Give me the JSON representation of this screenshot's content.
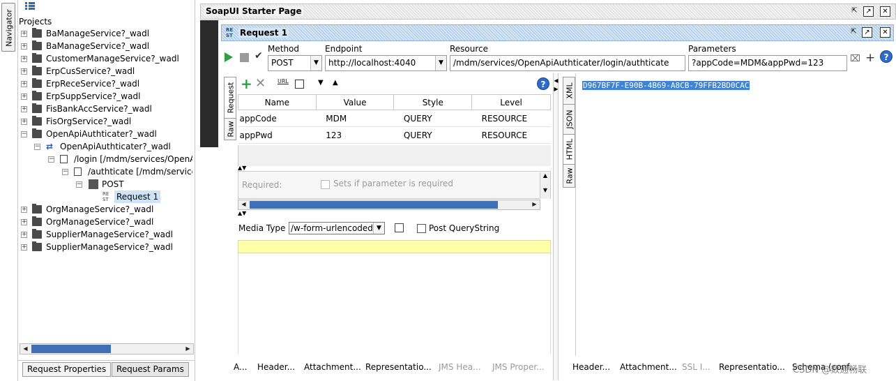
{
  "navigator": {
    "tab_label": "Navigator",
    "root_label": "Projects",
    "items": [
      {
        "label": "BaManageService?_wadl"
      },
      {
        "label": "BaManageService?_wadl"
      },
      {
        "label": "CustomerManageService?_wadl"
      },
      {
        "label": "ErpCusService?_wadl"
      },
      {
        "label": "ErpReceService?_wadl"
      },
      {
        "label": "ErpSuppService?_wadl"
      },
      {
        "label": "FisBankAccService?_wadl"
      },
      {
        "label": "FisOrgService?_wadl"
      },
      {
        "label": "OpenApiAuthticater?_wadl"
      },
      {
        "label": "OpenApiAuthticater?_wadl"
      },
      {
        "label": "/login [/mdm/services/OpenA"
      },
      {
        "label": "/authticate [/mdm/service"
      },
      {
        "label": "POST"
      },
      {
        "label": "Request 1"
      },
      {
        "label": "OrgManageService?_wadl"
      },
      {
        "label": "OrgManageService?_wadl"
      },
      {
        "label": "SupplierManageService?_wadl"
      },
      {
        "label": "SupplierManageService?_wadl"
      }
    ],
    "bottom_tabs": [
      "Request Properties",
      "Request Params"
    ]
  },
  "starter": {
    "title": "SoapUI Starter Page"
  },
  "request": {
    "title": "Request 1",
    "icon_text": "RE ST",
    "method": {
      "label": "Method",
      "value": "POST"
    },
    "endpoint": {
      "label": "Endpoint",
      "value": "http://localhost:4040"
    },
    "resource": {
      "label": "Resource",
      "value": "/mdm/services/OpenApiAuthticater/login/authticate"
    },
    "parameters": {
      "label": "Parameters",
      "value": "?appCode=MDM&appPwd=123"
    },
    "side_tabs": [
      "Request",
      "Raw"
    ],
    "table": {
      "headers": [
        "Name",
        "Value",
        "Style",
        "Level"
      ],
      "rows": [
        [
          "appCode",
          "MDM",
          "QUERY",
          "RESOURCE"
        ],
        [
          "appPwd",
          "123",
          "QUERY",
          "RESOURCE"
        ]
      ]
    },
    "required_label": "Required:",
    "required_desc": "Sets if parameter is required",
    "media_label": "Media Type",
    "media_value": "/w-form-urlencoded",
    "post_qs_label": "Post QueryString",
    "bottom_tabs": [
      "A...",
      "Header...",
      "Attachment...",
      "Representatio...",
      "JMS Hea...",
      "JMS Proper..."
    ]
  },
  "response": {
    "side_tabs": [
      "XML",
      "JSON",
      "HTML",
      "Raw"
    ],
    "content": "D967BF7F-E90B-4B69-A8CB-79FFB2BD0CAC",
    "bottom_tabs": [
      "Header...",
      "Attachment...",
      "SSL I...",
      "Representatio...",
      "Schema (conf..."
    ]
  },
  "watermark": "CSDN @数通畅联"
}
